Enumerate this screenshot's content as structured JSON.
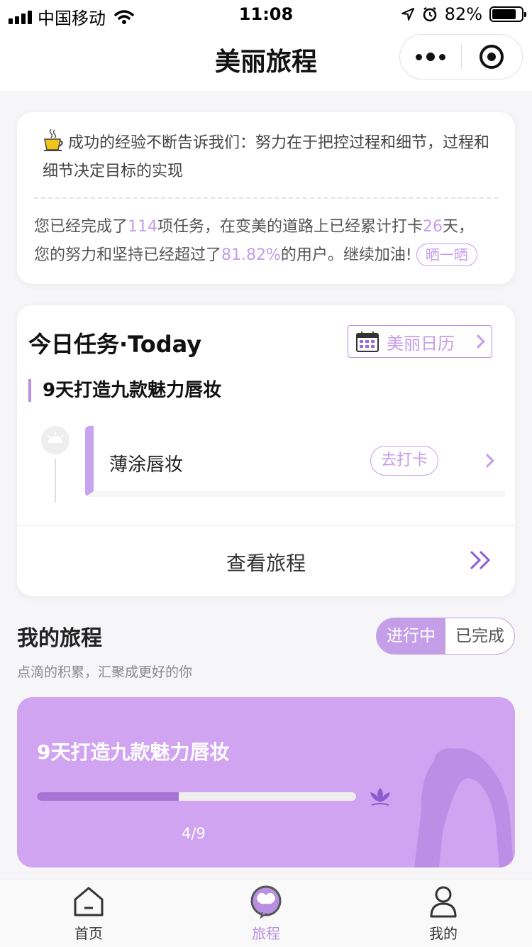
{
  "status_bar": {
    "carrier": "中国移动",
    "time": "11:08",
    "battery": "82%",
    "battery_level": 0.82
  },
  "nav": {
    "title": "美丽旅程"
  },
  "motto": {
    "text": "成功的经验不断告诉我们：努力在于把控过程和细节，过程和细节决定目标的实现"
  },
  "progress": {
    "p1": "您已经完成了",
    "tasks": "114",
    "p2": "项任务，在变美的道路上已经累计打卡",
    "days": "26",
    "p3": "天，",
    "p4": "您的努力和坚持已经超过了",
    "percent": "81.82%",
    "p5": "的用户。继续加油!",
    "share_label": "晒一晒"
  },
  "today": {
    "title": "今日任务·Today",
    "calendar_label": "美丽日历",
    "task_name": "9天打造九款魅力唇妆",
    "sub_task": "薄涂唇妆",
    "checkin_label": "去打卡",
    "view_label": "查看旅程"
  },
  "journey": {
    "title": "我的旅程",
    "subtitle": "点滴的积累，汇聚成更好的你",
    "tab_active": "进行中",
    "tab_inactive": "已完成",
    "card": {
      "title": "9天打造九款魅力唇妆",
      "progress": 0.444,
      "count": "4/9"
    }
  },
  "tabs": [
    {
      "label": "首页",
      "icon": "home-icon"
    },
    {
      "label": "旅程",
      "icon": "butterfly-icon"
    },
    {
      "label": "我的",
      "icon": "person-icon"
    }
  ],
  "colors": {
    "accent": "#c59ee8",
    "card_bg": "#d0a4f0",
    "progress_fill": "#a773d4"
  }
}
